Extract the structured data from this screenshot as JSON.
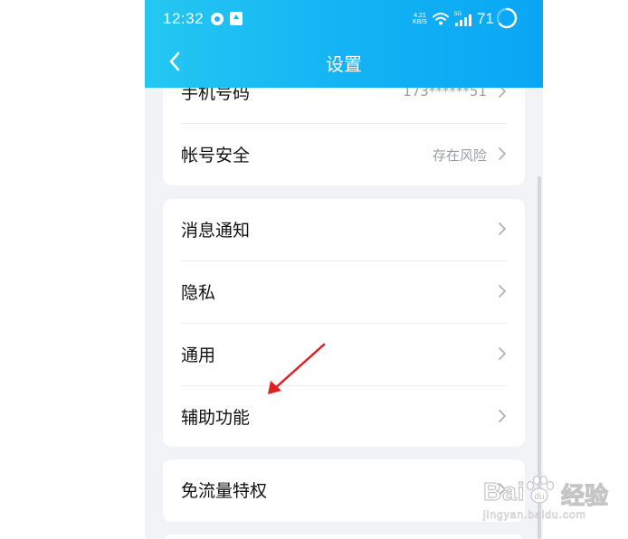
{
  "status_bar": {
    "time": "12:32",
    "net_speed_value": "4.21",
    "net_speed_unit": "KB/S",
    "signal_label": "5G",
    "battery": "71"
  },
  "nav": {
    "title": "设置"
  },
  "account_card": {
    "items": [
      {
        "label": "手机号码",
        "value": "173******51"
      },
      {
        "label": "帐号安全",
        "value": "存在风险"
      }
    ]
  },
  "general_card": {
    "items": [
      {
        "label": "消息通知"
      },
      {
        "label": "隐私"
      },
      {
        "label": "通用"
      },
      {
        "label": "辅助功能"
      }
    ]
  },
  "data_card": {
    "items": [
      {
        "label": "免流量特权"
      }
    ]
  },
  "annotation": {
    "arrow_color": "#e02020"
  },
  "watermark": {
    "brand_left": "Bai",
    "brand_right": "经验",
    "url": "jingyan.baidu.com"
  },
  "colors": {
    "header_gradient_start": "#25c7f2",
    "header_gradient_end": "#0aa6f5",
    "page_background": "#f2f3f7",
    "secondary_text": "#9a9ca3"
  }
}
